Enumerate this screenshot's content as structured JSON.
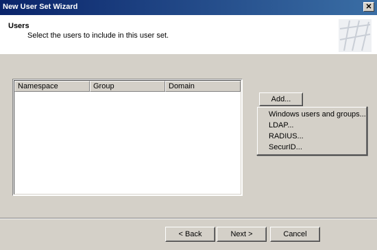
{
  "window": {
    "title": "New User Set Wizard",
    "close_glyph": "✕"
  },
  "header": {
    "title": "Users",
    "subtitle": "Select the users to include in this user set."
  },
  "list": {
    "columns": [
      "Namespace",
      "Group",
      "Domain"
    ]
  },
  "add_button": {
    "label": "Add..."
  },
  "add_menu": {
    "items": [
      "Windows users and groups...",
      "LDAP...",
      "RADIUS...",
      "SecurID..."
    ]
  },
  "footer": {
    "back_label": "< Back",
    "next_label": "Next >",
    "cancel_label": "Cancel"
  }
}
